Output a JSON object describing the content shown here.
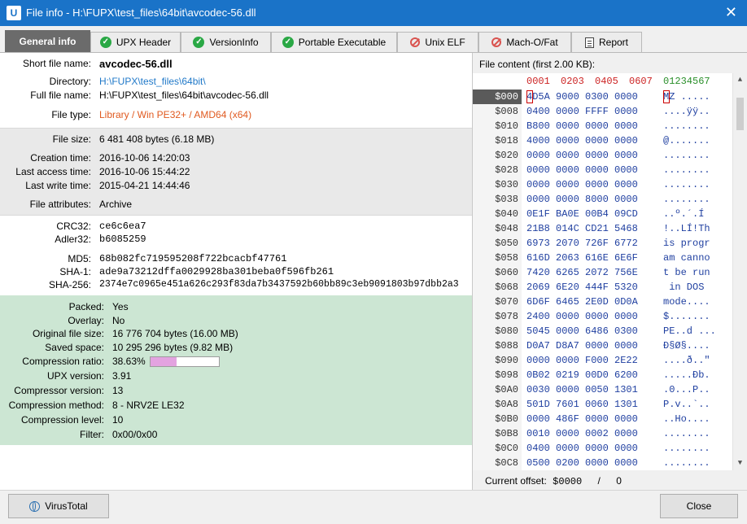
{
  "window": {
    "title": "File info - H:\\FUPX\\test_files\\64bit\\avcodec-56.dll",
    "app_icon": "U"
  },
  "tabs": [
    {
      "label": "General info",
      "status": "active"
    },
    {
      "label": "UPX Header",
      "status": "ok"
    },
    {
      "label": "VersionInfo",
      "status": "ok"
    },
    {
      "label": "Portable Executable",
      "status": "ok"
    },
    {
      "label": "Unix ELF",
      "status": "no"
    },
    {
      "label": "Mach-O/Fat",
      "status": "no"
    },
    {
      "label": "Report",
      "status": "doc"
    }
  ],
  "general": {
    "short_name_label": "Short file name:",
    "short_name": "avcodec-56.dll",
    "directory_label": "Directory:",
    "directory": "H:\\FUPX\\test_files\\64bit\\",
    "full_name_label": "Full file name:",
    "full_name": "H:\\FUPX\\test_files\\64bit\\avcodec-56.dll",
    "file_type_label": "File type:",
    "file_type": "Library / Win PE32+ / AMD64 (x64)"
  },
  "attrs": {
    "size_label": "File size:",
    "size": "6 481 408 bytes  (6.18 MB)",
    "ctime_label": "Creation time:",
    "ctime": "2016-10-06 14:20:03",
    "atime_label": "Last access time:",
    "atime": "2016-10-06 15:44:22",
    "mtime_label": "Last write time:",
    "mtime": "2015-04-21 14:44:46",
    "attributes_label": "File attributes:",
    "attributes": "Archive"
  },
  "hashes": {
    "crc32_label": "CRC32:",
    "crc32": "ce6c6ea7",
    "adler32_label": "Adler32:",
    "adler32": "b6085259",
    "md5_label": "MD5:",
    "md5": "68b082fc719595208f722bcacbf47761",
    "sha1_label": "SHA-1:",
    "sha1": "ade9a73212dffa0029928ba301beba0f596fb261",
    "sha256_label": "SHA-256:",
    "sha256": "2374e7c0965e451a626c293f83da7b3437592b60bb89c3eb9091803b97dbb2a3"
  },
  "upx": {
    "packed_label": "Packed:",
    "packed": "Yes",
    "overlay_label": "Overlay:",
    "overlay": "No",
    "orig_size_label": "Original file size:",
    "orig_size": "16 776 704 bytes  (16.00 MB)",
    "saved_label": "Saved space:",
    "saved": "10 295 296 bytes  (9.82 MB)",
    "ratio_label": "Compression ratio:",
    "ratio": "38.63%",
    "ratio_fraction": 0.3863,
    "version_label": "UPX version:",
    "version": "3.91",
    "compressor_label": "Compressor version:",
    "compressor": "13",
    "method_label": "Compression method:",
    "method": "8 - NRV2E LE32",
    "level_label": "Compression level:",
    "level": "10",
    "filter_label": "Filter:",
    "filter": "0x00/0x00"
  },
  "hexview": {
    "title": "File content (first 2.00 KB):",
    "header_hex": [
      "0001",
      "0203",
      "0405",
      "0607"
    ],
    "header_ascii": "01234567",
    "rows": [
      {
        "off": "$000",
        "hex": "4D5A 9000 0300 0000",
        "ascii": "MZ ....."
      },
      {
        "off": "$008",
        "hex": "0400 0000 FFFF 0000",
        "ascii": "....ÿÿ.."
      },
      {
        "off": "$010",
        "hex": "B800 0000 0000 0000",
        "ascii": "........"
      },
      {
        "off": "$018",
        "hex": "4000 0000 0000 0000",
        "ascii": "@......."
      },
      {
        "off": "$020",
        "hex": "0000 0000 0000 0000",
        "ascii": "........"
      },
      {
        "off": "$028",
        "hex": "0000 0000 0000 0000",
        "ascii": "........"
      },
      {
        "off": "$030",
        "hex": "0000 0000 0000 0000",
        "ascii": "........"
      },
      {
        "off": "$038",
        "hex": "0000 0000 8000 0000",
        "ascii": "........"
      },
      {
        "off": "$040",
        "hex": "0E1F BA0E 00B4 09CD",
        "ascii": "..º.´.Í"
      },
      {
        "off": "$048",
        "hex": "21B8 014C CD21 5468",
        "ascii": "!..LÍ!Th"
      },
      {
        "off": "$050",
        "hex": "6973 2070 726F 6772",
        "ascii": "is progr"
      },
      {
        "off": "$058",
        "hex": "616D 2063 616E 6E6F",
        "ascii": "am canno"
      },
      {
        "off": "$060",
        "hex": "7420 6265 2072 756E",
        "ascii": "t be run"
      },
      {
        "off": "$068",
        "hex": "2069 6E20 444F 5320",
        "ascii": " in DOS "
      },
      {
        "off": "$070",
        "hex": "6D6F 6465 2E0D 0D0A",
        "ascii": "mode...."
      },
      {
        "off": "$078",
        "hex": "2400 0000 0000 0000",
        "ascii": "$......."
      },
      {
        "off": "$080",
        "hex": "5045 0000 6486 0300",
        "ascii": "PE..d ..."
      },
      {
        "off": "$088",
        "hex": "D0A7 D8A7 0000 0000",
        "ascii": "Ð§Ø§...."
      },
      {
        "off": "$090",
        "hex": "0000 0000 F000 2E22",
        "ascii": "....ð..\""
      },
      {
        "off": "$098",
        "hex": "0B02 0219 00D0 6200",
        "ascii": ".....Ðb."
      },
      {
        "off": "$0A0",
        "hex": "0030 0000 0050 1301",
        "ascii": ".0...P.."
      },
      {
        "off": "$0A8",
        "hex": "501D 7601 0060 1301",
        "ascii": "P.v..`.."
      },
      {
        "off": "$0B0",
        "hex": "0000 486F 0000 0000",
        "ascii": "..Ho...."
      },
      {
        "off": "$0B8",
        "hex": "0010 0000 0002 0000",
        "ascii": "........"
      },
      {
        "off": "$0C0",
        "hex": "0400 0000 0000 0000",
        "ascii": "........"
      },
      {
        "off": "$0C8",
        "hex": "0500 0200 0000 0000",
        "ascii": "........"
      }
    ],
    "offset_label": "Current offset:",
    "offset_value": "$0000",
    "offset_sep": "/",
    "offset_dec": "0"
  },
  "footer": {
    "virustotal": "VirusTotal",
    "close": "Close"
  },
  "colors": {
    "titlebar": "#1a73c8",
    "upx_section": "#cce6d3",
    "attr_section": "#e9e9e9",
    "file_type": "#e05a20",
    "directory": "#1f78c8"
  }
}
